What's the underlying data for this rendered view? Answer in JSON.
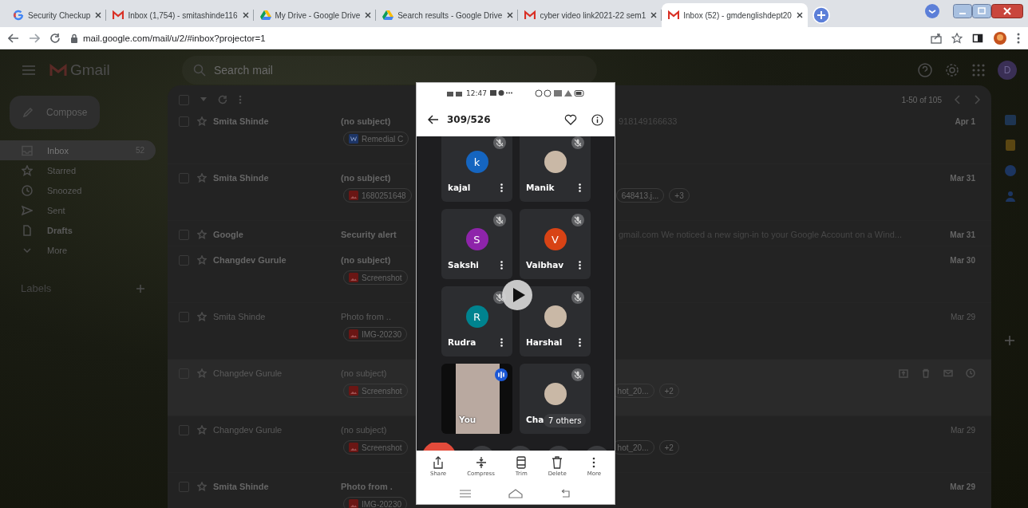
{
  "browser": {
    "tabs": [
      {
        "title": "Security Checkup",
        "kind": "google",
        "selected": false
      },
      {
        "title": "Inbox (1,754) - smitashinde116",
        "kind": "gmail",
        "selected": false
      },
      {
        "title": "My Drive - Google Drive",
        "kind": "drive",
        "selected": false
      },
      {
        "title": "Search results - Google Drive",
        "kind": "drive",
        "selected": false
      },
      {
        "title": "cyber video link2021-22 sem1",
        "kind": "gmail",
        "selected": false
      },
      {
        "title": "Inbox (52) - gmdenglishdept20",
        "kind": "gmail",
        "selected": true
      }
    ],
    "address": "mail.google.com/mail/u/2/#inbox?projector=1"
  },
  "gmail": {
    "app_name": "Gmail",
    "search": {
      "placeholder": "Search mail"
    },
    "avatar_letter": "D",
    "compose": "Compose",
    "nav": [
      {
        "label": "Inbox",
        "kind": "inbox",
        "count": "52",
        "selected": true,
        "bold": false
      },
      {
        "label": "Starred",
        "kind": "star",
        "selected": false,
        "bold": false
      },
      {
        "label": "Snoozed",
        "kind": "clock",
        "selected": false,
        "bold": false
      },
      {
        "label": "Sent",
        "kind": "send",
        "selected": false,
        "bold": false
      },
      {
        "label": "Drafts",
        "kind": "file",
        "selected": false,
        "bold": true
      },
      {
        "label": "More",
        "kind": "chevron",
        "selected": false,
        "bold": false
      }
    ],
    "labels_heading": "Labels",
    "select_all": {
      "checked": false
    },
    "pagination": "1-50 of 105",
    "emails": [
      {
        "sender": "Smita Shinde",
        "subject": "(no subject)",
        "snippet": "918149166633",
        "attachment": {
          "kind": "doc",
          "name": "Remedial C"
        },
        "date": "Apr 1",
        "unread": true,
        "hovered": false,
        "checked": false
      },
      {
        "sender": "Smita Shinde",
        "subject": "(no subject)",
        "attachment": {
          "kind": "image",
          "name": "1680251648"
        },
        "more_chips": [
          "648413.j...",
          "+3"
        ],
        "date": "Mar 31",
        "unread": true,
        "hovered": false,
        "checked": false
      },
      {
        "sender": "Google",
        "subject": "Security alert",
        "snippet": "gmail.com We noticed a new sign-in to your Google Account on a Wind...",
        "date": "Mar 31",
        "unread": true,
        "hovered": false,
        "checked": false
      },
      {
        "sender": "Changdev Gurule",
        "subject": "(no subject)",
        "attachment": {
          "kind": "image",
          "name": "Screenshot"
        },
        "date": "Mar 30",
        "unread": true,
        "hovered": false,
        "checked": false
      },
      {
        "sender": "Smita Shinde",
        "subject": "Photo from ..",
        "attachment": {
          "kind": "image",
          "name": "IMG-20230"
        },
        "date": "Mar 29",
        "unread": false,
        "hovered": false,
        "checked": false
      },
      {
        "sender": "Changdev Gurule",
        "subject": "(no subject)",
        "attachment": {
          "kind": "image",
          "name": "Screenshot"
        },
        "more_chips": [
          "hot_20...",
          "+2"
        ],
        "unread": false,
        "hovered": true,
        "checked": false
      },
      {
        "sender": "Changdev Gurule",
        "subject": "(no subject)",
        "attachment": {
          "kind": "image",
          "name": "Screenshot"
        },
        "more_chips": [
          "hot_20...",
          "+2"
        ],
        "date": "Mar 29",
        "unread": false,
        "hovered": false,
        "checked": false
      },
      {
        "sender": "Smita Shinde",
        "subject": "Photo from .",
        "attachment": {
          "kind": "image",
          "name": "IMG-20230"
        },
        "date": "Mar 29",
        "unread": true,
        "hovered": false,
        "checked": false
      }
    ]
  },
  "viewer": {
    "time": "12:47",
    "counter": "309/526",
    "participants": [
      {
        "name": "kajal",
        "kind": "letter",
        "letter": "k",
        "color": "#1565c0",
        "muted": true,
        "speaking": false
      },
      {
        "name": "Manik",
        "kind": "photo",
        "muted": true,
        "speaking": false
      },
      {
        "name": "Sakshi",
        "kind": "letter",
        "letter": "S",
        "color": "#8e24aa",
        "muted": true,
        "speaking": false
      },
      {
        "name": "Vaibhav",
        "kind": "letter",
        "letter": "V",
        "color": "#d84315",
        "muted": true,
        "speaking": false
      },
      {
        "name": "Rudra",
        "kind": "letter",
        "letter": "R",
        "color": "#00838f",
        "muted": true,
        "speaking": false
      },
      {
        "name": "Harshal",
        "kind": "photo",
        "muted": true,
        "speaking": false
      },
      {
        "name": "You",
        "kind": "video",
        "muted": false,
        "speaking": true
      },
      {
        "name": "Cha",
        "kind": "photo",
        "muted": true,
        "speaking": false,
        "badge": "7 others"
      }
    ],
    "actions": [
      {
        "label": "Share",
        "kind": "share"
      },
      {
        "label": "Compress",
        "kind": "compress"
      },
      {
        "label": "Trim",
        "kind": "trim"
      },
      {
        "label": "Delete",
        "kind": "delete"
      },
      {
        "label": "More",
        "kind": "more"
      }
    ]
  }
}
